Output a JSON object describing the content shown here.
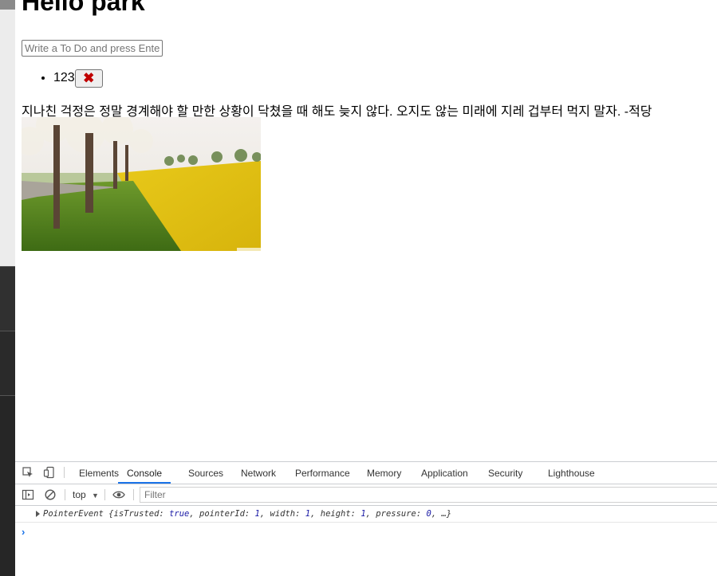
{
  "page": {
    "title": "Hello park",
    "todo_input_placeholder": "Write a To Do and press Enter",
    "todos": [
      {
        "text": "123",
        "delete_label": "✖"
      }
    ],
    "quote": "지나친 걱정은 정말 경계해야 할 만한 상황이 닥쳤을 때 해도 늦지 않다. 오지도 않는 미래에 지레 겁부터 먹지 말자. -적당"
  },
  "devtools": {
    "tabs": [
      "Elements",
      "Console",
      "Sources",
      "Network",
      "Performance",
      "Memory",
      "Application",
      "Security",
      "Lighthouse"
    ],
    "active_tab": "Console",
    "context": "top",
    "filter_placeholder": "Filter",
    "log": {
      "prefix": "PointerEvent {",
      "k1": "isTrusted: ",
      "v1": "true",
      "k2": ", pointerId: ",
      "v2": "1",
      "k3": ", width: ",
      "v3": "1",
      "k4": ", height: ",
      "v4": "1",
      "k5": ", pressure: ",
      "v5": "0",
      "suffix": ", …}"
    },
    "prompt": "›"
  },
  "icons": [
    "inspect-icon",
    "device-toggle-icon",
    "sidebar-toggle-icon",
    "clear-console-icon",
    "eye-icon",
    "dropdown-arrow-icon",
    "delete-x-icon",
    "expand-triangle-icon"
  ],
  "colors": {
    "accent": "#1a73e8",
    "delete_icon": "#c00000",
    "value_blue": "#1a1aa6"
  }
}
